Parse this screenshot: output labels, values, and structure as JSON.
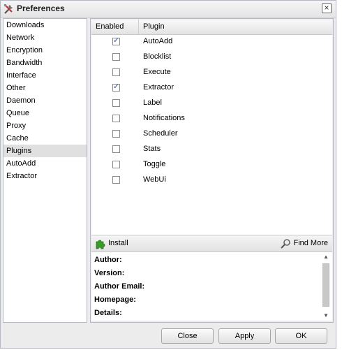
{
  "window": {
    "title": "Preferences"
  },
  "categories": [
    "Downloads",
    "Network",
    "Encryption",
    "Bandwidth",
    "Interface",
    "Other",
    "Daemon",
    "Queue",
    "Proxy",
    "Cache",
    "Plugins",
    "AutoAdd",
    "Extractor"
  ],
  "selected_category": "Plugins",
  "grid": {
    "headers": {
      "enabled": "Enabled",
      "plugin": "Plugin"
    },
    "rows": [
      {
        "name": "AutoAdd",
        "enabled": true
      },
      {
        "name": "Blocklist",
        "enabled": false
      },
      {
        "name": "Execute",
        "enabled": false
      },
      {
        "name": "Extractor",
        "enabled": true
      },
      {
        "name": "Label",
        "enabled": false
      },
      {
        "name": "Notifications",
        "enabled": false
      },
      {
        "name": "Scheduler",
        "enabled": false
      },
      {
        "name": "Stats",
        "enabled": false
      },
      {
        "name": "Toggle",
        "enabled": false
      },
      {
        "name": "WebUi",
        "enabled": false
      }
    ]
  },
  "toolbar": {
    "install_label": "Install",
    "find_more_label": "Find More"
  },
  "details": {
    "author": "Author:",
    "version": "Version:",
    "author_email": "Author Email:",
    "homepage": "Homepage:",
    "details": "Details:"
  },
  "footer": {
    "close": "Close",
    "apply": "Apply",
    "ok": "OK"
  }
}
